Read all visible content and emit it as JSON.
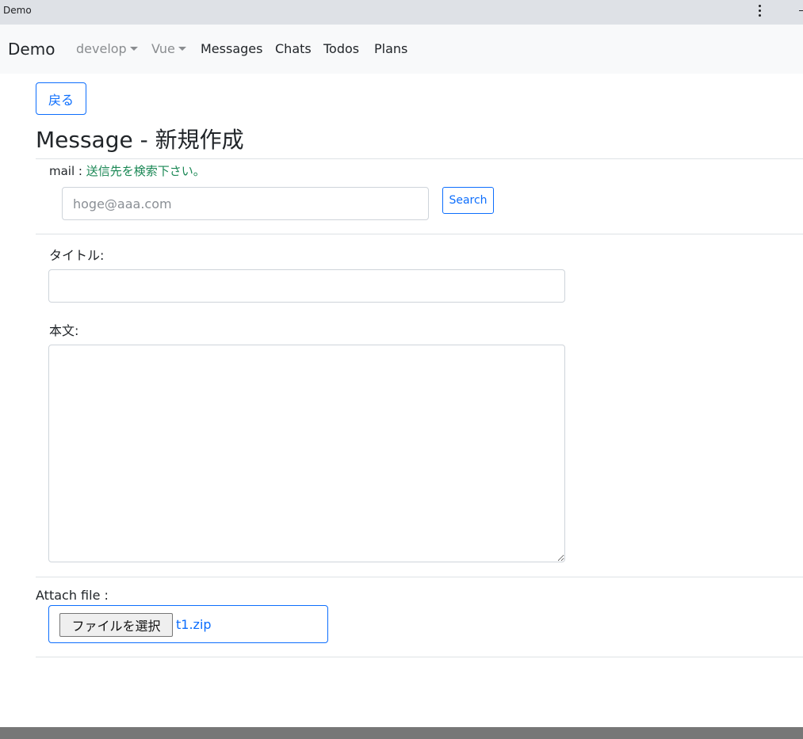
{
  "window": {
    "title": "Demo"
  },
  "navbar": {
    "brand": "Demo",
    "dropdowns": [
      {
        "label": "develop"
      },
      {
        "label": "Vue"
      }
    ],
    "links": [
      {
        "label": "Messages"
      },
      {
        "label": "Chats"
      },
      {
        "label": "Todos"
      },
      {
        "label": "Plans"
      }
    ]
  },
  "page": {
    "back_label": "戻る",
    "title": "Message - 新規作成"
  },
  "mail": {
    "label": "mail : ",
    "hint": "送信先を検索下さい。",
    "placeholder": "hoge@aaa.com",
    "value": "",
    "search_label": "Search"
  },
  "form": {
    "title_label": "タイトル:",
    "title_value": "",
    "body_label": "本文:",
    "body_value": ""
  },
  "attach": {
    "label": "Attach file :",
    "button_label": "ファイルを選択",
    "file_name": "t1.zip"
  },
  "colors": {
    "primary": "#0d6efd",
    "hint_green": "#198754",
    "navbar_bg": "#f8f9fa",
    "titlebar_bg": "#dee1e6",
    "footer_bg": "#777777"
  }
}
